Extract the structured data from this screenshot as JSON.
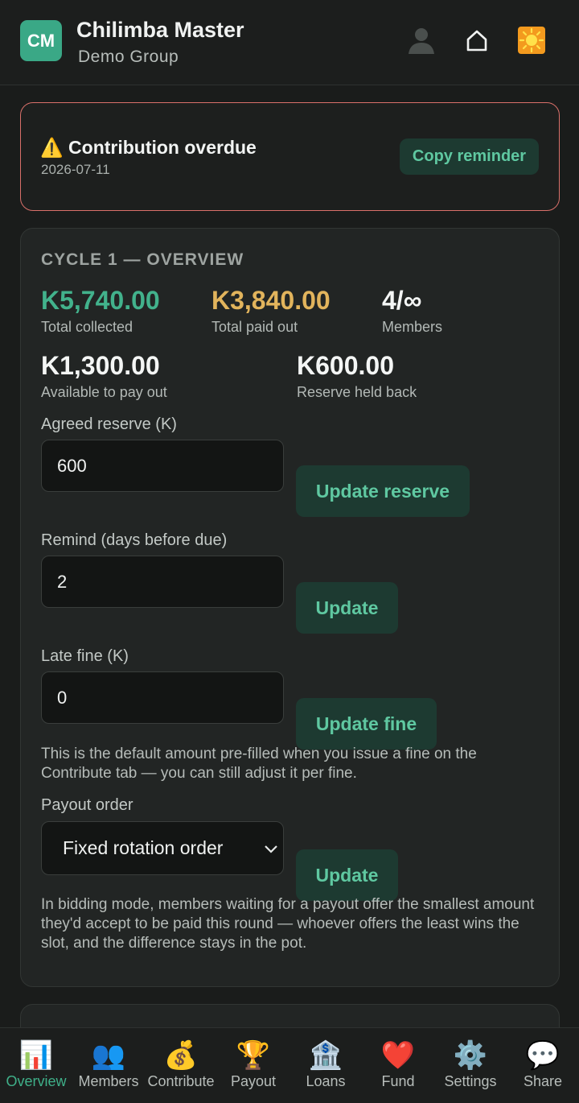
{
  "header": {
    "logo_text": "CM",
    "app_title": "Chilimba Master",
    "group_name": "Demo Group",
    "icons": [
      "profile-icon",
      "home-icon",
      "theme-toggle-icon"
    ]
  },
  "alert": {
    "icon": "⚠️",
    "title": "Contribution overdue",
    "date": "2026-07-11",
    "button_label": "Copy reminder",
    "border_color": "#d9706a"
  },
  "overview": {
    "heading": "CYCLE 1 — OVERVIEW",
    "stats": {
      "total_collected": {
        "value": "K5,740.00",
        "label": "Total collected",
        "color": "#42b28c"
      },
      "total_paid_out": {
        "value": "K3,840.00",
        "label": "Total paid out",
        "color": "#e2b45c"
      },
      "members": {
        "value": "4/∞",
        "label": "Members"
      },
      "available": {
        "value": "K1,300.00",
        "label": "Available to pay out"
      },
      "reserve": {
        "value": "K600.00",
        "label": "Reserve held back"
      }
    },
    "reserve_field": {
      "label": "Agreed reserve (K)",
      "value": "600",
      "button": "Update reserve"
    },
    "remind_field": {
      "label": "Remind (days before due)",
      "value": "2",
      "button": "Update"
    },
    "fine_field": {
      "label": "Late fine (K)",
      "value": "0",
      "button": "Update fine",
      "help": "This is the default amount pre-filled when you issue a fine on the Contribute tab — you can still adjust it per fine."
    },
    "payout_field": {
      "label": "Payout order",
      "selected": "Fixed rotation order",
      "button": "Update",
      "help": "In bidding mode, members waiting for a payout offer the smallest amount they'd accept to be paid this round — whoever offers the least wins the slot, and the difference stays in the pot."
    }
  },
  "bottom_nav": {
    "active": "Overview",
    "accent": "#3fb089",
    "items": [
      {
        "label": "Overview",
        "icon": "📊"
      },
      {
        "label": "Members",
        "icon": "👥"
      },
      {
        "label": "Contribute",
        "icon": "💰"
      },
      {
        "label": "Payout",
        "icon": "🏆"
      },
      {
        "label": "Loans",
        "icon": "🏦"
      },
      {
        "label": "Fund",
        "icon": "❤️"
      },
      {
        "label": "Settings",
        "icon": "⚙️"
      },
      {
        "label": "Share",
        "icon": "💬"
      }
    ]
  }
}
